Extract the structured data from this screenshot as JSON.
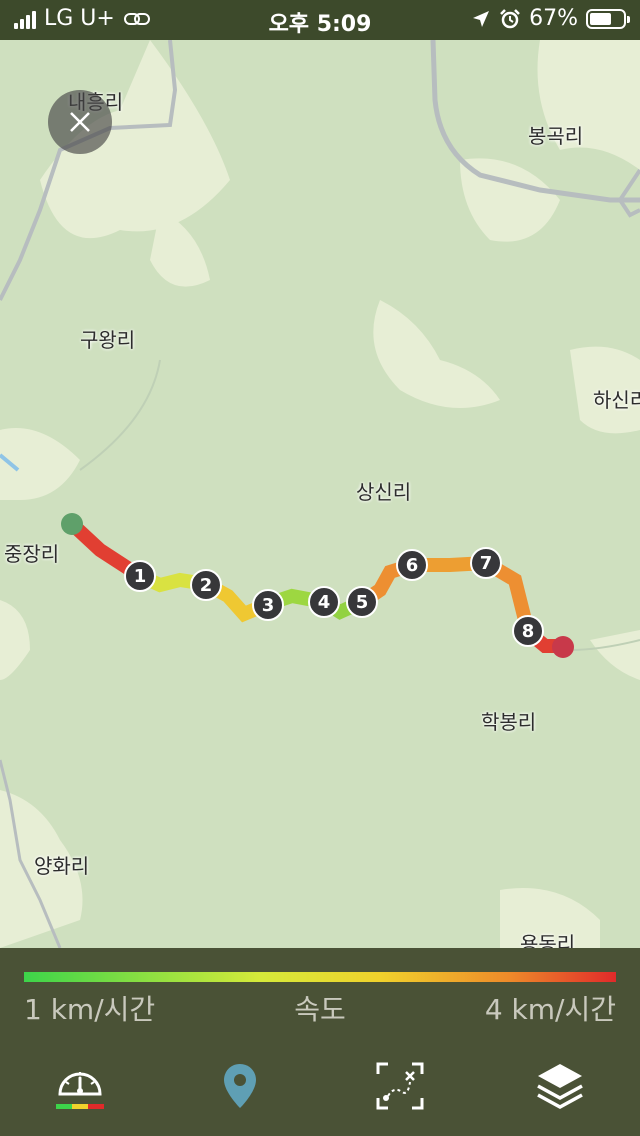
{
  "status": {
    "carrier": "LG U+",
    "time": "오후 5:09",
    "battery": "67%",
    "battery_level": 0.67
  },
  "map": {
    "places": [
      "내흥리",
      "봉곡리",
      "구왕리",
      "하신리",
      "상신리",
      "중장리",
      "학봉리",
      "양화리",
      "용동리"
    ],
    "markers": [
      "1",
      "2",
      "3",
      "4",
      "5",
      "6",
      "7",
      "8"
    ],
    "start_color": "#5fa06a",
    "end_color": "#c8394a"
  },
  "legend": {
    "min_label": "1 km/시간",
    "title": "속도",
    "max_label": "4 km/시간",
    "colors": [
      "#3dd44a",
      "#d6ea3a",
      "#f0d22c",
      "#ee8a2a",
      "#e02a2a"
    ]
  },
  "tabs": [
    "speedometer-icon",
    "location-pin-icon",
    "route-map-icon",
    "layers-icon"
  ]
}
